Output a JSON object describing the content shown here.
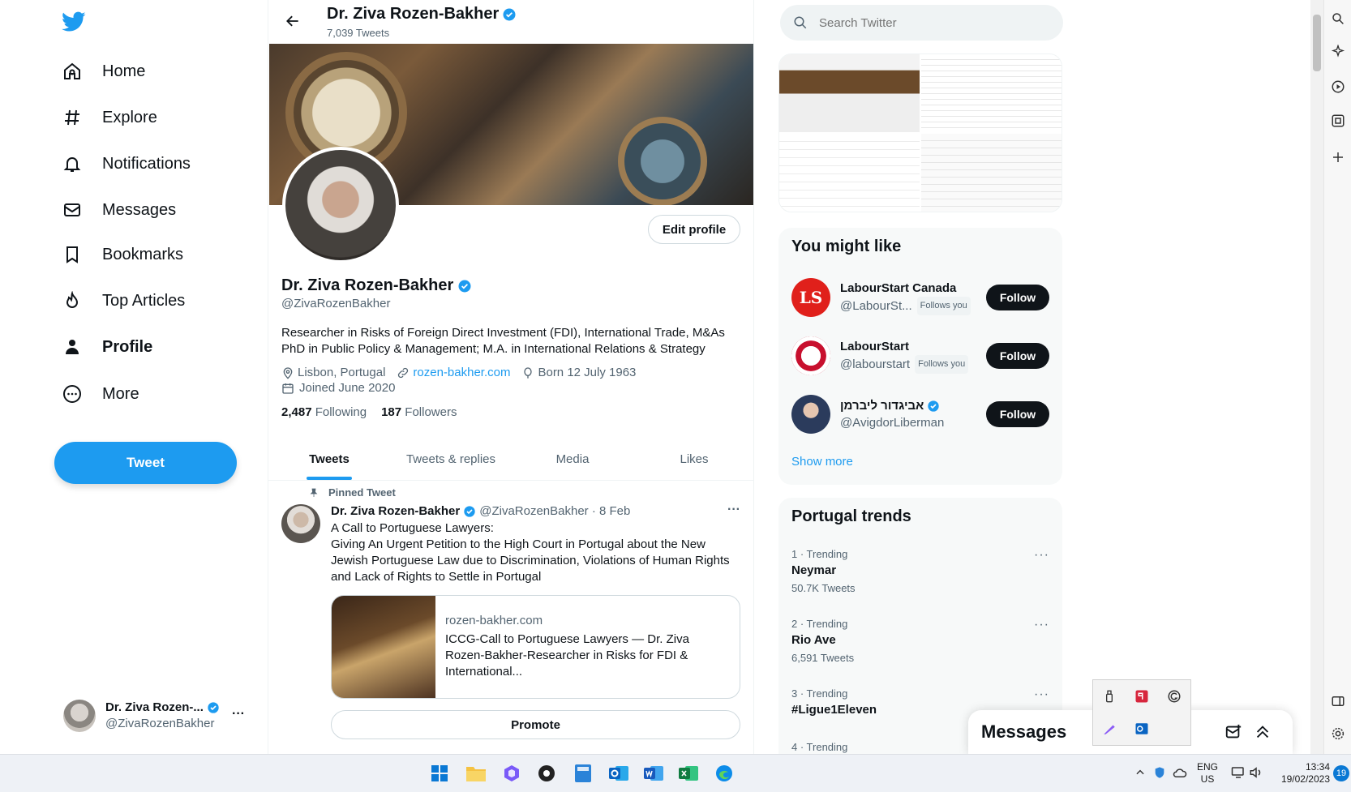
{
  "nav": {
    "items": [
      {
        "label": "Home"
      },
      {
        "label": "Explore"
      },
      {
        "label": "Notifications"
      },
      {
        "label": "Messages"
      },
      {
        "label": "Bookmarks"
      },
      {
        "label": "Top Articles"
      },
      {
        "label": "Profile"
      },
      {
        "label": "More"
      }
    ],
    "tweet_button": "Tweet",
    "account": {
      "name": "Dr. Ziva Rozen-...",
      "handle": "@ZivaRozenBakher",
      "more": "···"
    }
  },
  "header": {
    "name": "Dr. Ziva Rozen-Bakher",
    "tweet_count": "7,039 Tweets"
  },
  "profile": {
    "edit_button": "Edit profile",
    "name": "Dr. Ziva Rozen-Bakher",
    "handle": "@ZivaRozenBakher",
    "bio_line1": "Researcher in Risks of Foreign Direct Investment (FDI), International Trade, M&As",
    "bio_line2": "PhD in Public Policy & Management; M.A. in International Relations & Strategy",
    "location": "Lisbon, Portugal",
    "website": "rozen-bakher.com",
    "born": "Born 12 July 1963",
    "joined": "Joined June 2020",
    "following_count": "2,487",
    "following_label": "Following",
    "followers_count": "187",
    "followers_label": "Followers"
  },
  "tabs": [
    {
      "label": "Tweets"
    },
    {
      "label": "Tweets & replies"
    },
    {
      "label": "Media"
    },
    {
      "label": "Likes"
    }
  ],
  "pinned_tweet": {
    "pinned_label": "Pinned Tweet",
    "author": "Dr. Ziva Rozen-Bakher",
    "handle_date": "@ZivaRozenBakher · 8 Feb",
    "more": "···",
    "line1": "A Call to Portuguese Lawyers:",
    "line2": "Giving An Urgent Petition to the High Court in Portugal about the New",
    "line3": "Jewish Portuguese Law due to Discrimination, Violations of Human Rights",
    "line4": "and Lack of Rights to Settle in Portugal",
    "card_domain": "rozen-bakher.com",
    "card_line1": "ICCG-Call to Portuguese Lawyers — Dr. Ziva",
    "card_line2": "Rozen-Bakher-Researcher in Risks for FDI &",
    "card_line3": "International...",
    "promote": "Promote"
  },
  "search": {
    "placeholder": "Search Twitter"
  },
  "who_to_follow": {
    "title": "You might like",
    "show_more": "Show more",
    "people": [
      {
        "name": "LabourStart Canada",
        "handle": "@LabourSt...",
        "badge": "Follows you",
        "button": "Follow",
        "avatar_text": "LS",
        "color": "#e0201b"
      },
      {
        "name": "LabourStart",
        "handle": "@labourstart",
        "badge": "Follows you",
        "button": "Follow",
        "color": "#c8102e"
      },
      {
        "name": "אביגדור ליברמן",
        "handle": "@AvigdorLiberman",
        "badge": "",
        "button": "Follow",
        "color": "#2b3b5c"
      }
    ]
  },
  "trends": {
    "title": "Portugal trends",
    "items": [
      {
        "meta": "1 · Trending",
        "name": "Neymar",
        "count": "50.7K Tweets"
      },
      {
        "meta": "2 · Trending",
        "name": "Rio Ave",
        "count": "6,591 Tweets"
      },
      {
        "meta": "3 · Trending",
        "name": "#Ligue1Eleven",
        "count": ""
      },
      {
        "meta": "4 · Trending",
        "name": "",
        "count": ""
      }
    ],
    "more": "···"
  },
  "messages_drawer": {
    "title": "Messages"
  },
  "taskbar": {
    "lang_top": "ENG",
    "lang_bottom": "US",
    "time": "13:34",
    "date": "19/02/2023",
    "notif": "19"
  },
  "colors": {
    "accent": "#1d9bf0",
    "text": "#0f1419",
    "muted": "#536471"
  }
}
